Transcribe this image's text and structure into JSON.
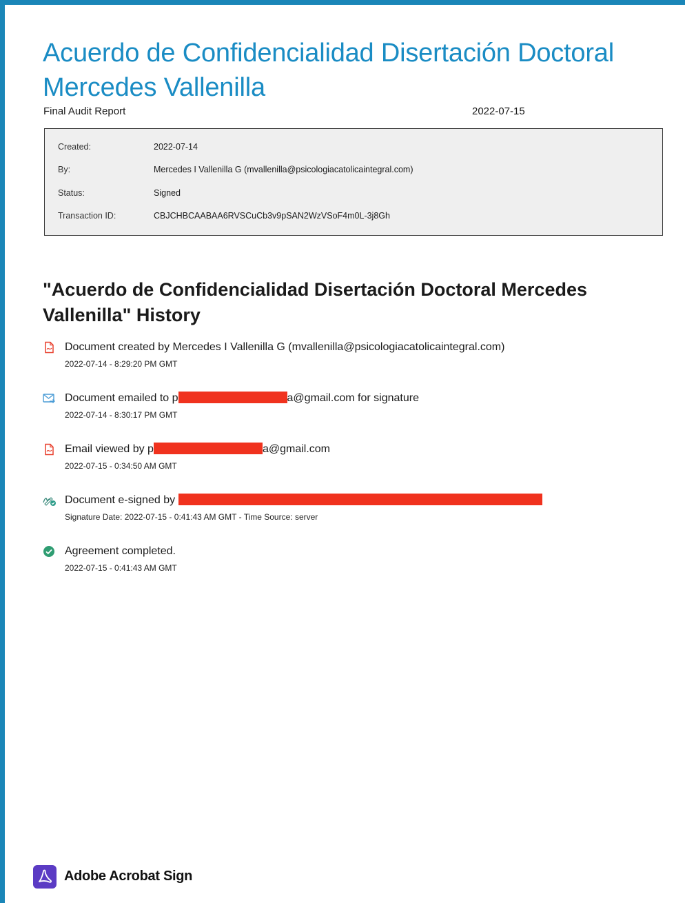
{
  "document": {
    "title": "Acuerdo de Confidencialidad Disertación Doctoral Mercedes Vallenilla",
    "report_label": "Final Audit Report",
    "report_date": "2022-07-15"
  },
  "info": {
    "rows": [
      {
        "key": "Created:",
        "value": "2022-07-14"
      },
      {
        "key": "By:",
        "value": "Mercedes I Vallenilla G (mvallenilla@psicologiacatolicaintegral.com)"
      },
      {
        "key": "Status:",
        "value": "Signed"
      },
      {
        "key": "Transaction ID:",
        "value": "CBJCHBCAABAA6RVSCuCb3v9pSAN2WzVSoF4m0L-3j8Gh"
      }
    ]
  },
  "history": {
    "title": "\"Acuerdo de Confidencialidad Disertación Doctoral Mercedes Vallenilla\" History",
    "events": [
      {
        "icon": "document-icon",
        "text_before": "Document created by Mercedes I Vallenilla G (mvallenilla@psicologiacatolicaintegral.com)",
        "text_after": "",
        "detail": "2022-07-14 - 8:29:20 PM GMT"
      },
      {
        "icon": "email-icon",
        "text_before": "Document emailed to p",
        "text_after": "a@gmail.com for signature",
        "detail": "2022-07-14 - 8:30:17 PM GMT"
      },
      {
        "icon": "document-icon",
        "text_before": "Email viewed by p",
        "text_after": "a@gmail.com",
        "detail": "2022-07-15 - 0:34:50 AM GMT"
      },
      {
        "icon": "signature-icon",
        "text_before": "Document e-signed by ",
        "text_after": "",
        "detail": "Signature Date: 2022-07-15 - 0:41:43 AM GMT - Time Source: server"
      },
      {
        "icon": "check-circle-icon",
        "text_before": "Agreement completed.",
        "text_after": "",
        "detail": "2022-07-15 - 0:41:43 AM GMT"
      }
    ]
  },
  "footer": {
    "brand": "Adobe Acrobat Sign",
    "icon": "acrobat-logo-icon"
  },
  "colors": {
    "accent": "#1a86b8",
    "title": "#1a8cc4",
    "redaction": "#f0321e",
    "brand_logo": "#5b3bc4"
  }
}
